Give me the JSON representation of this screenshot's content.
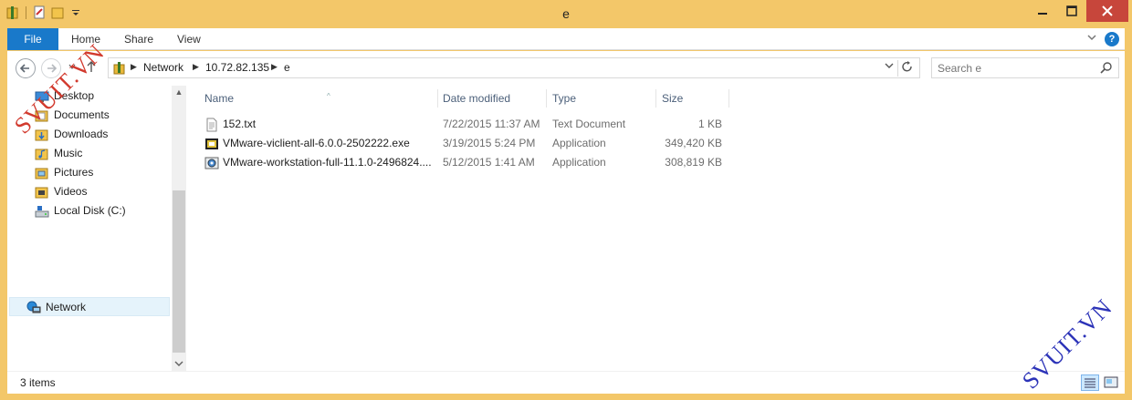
{
  "window": {
    "title": "e",
    "minimize_icon": "minimize-icon",
    "maximize_icon": "maximize-icon",
    "close_icon": "close-icon"
  },
  "ribbon": {
    "tabs": [
      {
        "label": "File"
      },
      {
        "label": "Home"
      },
      {
        "label": "Share"
      },
      {
        "label": "View"
      }
    ],
    "accent": "#1979ca"
  },
  "address": {
    "crumbs": [
      "Network",
      "10.72.82.135",
      "e"
    ]
  },
  "search": {
    "placeholder": "Search e"
  },
  "navpane": {
    "items": [
      {
        "label": "Desktop",
        "icon": "desktop-folder-icon"
      },
      {
        "label": "Documents",
        "icon": "documents-folder-icon"
      },
      {
        "label": "Downloads",
        "icon": "downloads-folder-icon"
      },
      {
        "label": "Music",
        "icon": "music-folder-icon"
      },
      {
        "label": "Pictures",
        "icon": "pictures-folder-icon"
      },
      {
        "label": "Videos",
        "icon": "videos-folder-icon"
      },
      {
        "label": "Local Disk (C:)",
        "icon": "drive-icon"
      }
    ],
    "network": {
      "label": "Network",
      "icon": "network-icon"
    }
  },
  "columns": {
    "name": "Name",
    "date": "Date modified",
    "type": "Type",
    "size": "Size"
  },
  "files": [
    {
      "name": "152.txt",
      "date": "7/22/2015 11:37 AM",
      "type": "Text Document",
      "size": "1 KB",
      "icon": "text-file-icon"
    },
    {
      "name": "VMware-viclient-all-6.0.0-2502222.exe",
      "date": "3/19/2015 5:24 PM",
      "type": "Application",
      "size": "349,420 KB",
      "icon": "application-icon"
    },
    {
      "name": "VMware-workstation-full-11.1.0-2496824....",
      "date": "5/12/2015 1:41 AM",
      "type": "Application",
      "size": "308,819 KB",
      "icon": "installer-icon"
    }
  ],
  "status": {
    "item_count": "3 items"
  },
  "watermarks": {
    "top_left": "SVUIT.VN",
    "bottom_right": "SVUIT.VN"
  },
  "colors": {
    "frame": "#f3c769",
    "close_button": "#c7463b",
    "selection": "#e5f3fb"
  }
}
